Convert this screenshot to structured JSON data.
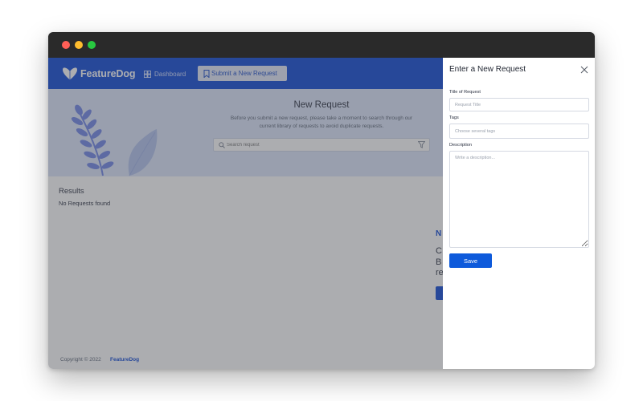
{
  "app": {
    "brand": "FeatureDog",
    "nav": {
      "dashboard_label": "Dashboard",
      "submit_label": "Submit a New Request"
    }
  },
  "hero": {
    "title": "New Request",
    "subtitle": "Before you submit a new request, please take a moment to search through our current library of requests to avoid duplicate requests.",
    "search_placeholder": "Search request"
  },
  "results": {
    "title": "Results",
    "empty_text": "No Requests found"
  },
  "promo": {
    "title_fragment": "N",
    "text_fragment": "C\nB\nre"
  },
  "footer": {
    "copyright": "Copyright © 2022",
    "brand": "FeatureDog"
  },
  "drawer": {
    "title": "Enter a New Request",
    "fields": {
      "title_label": "Title of Request",
      "title_placeholder": "Request Title",
      "tags_label": "Tags",
      "tags_placeholder": "Choose several tags",
      "description_label": "Description",
      "description_placeholder": "Write a description..."
    },
    "save_label": "Save"
  },
  "colors": {
    "brand_blue": "#0e48d6",
    "hero_bg": "#dde6fb",
    "titlebar": "#2a2a2a"
  }
}
